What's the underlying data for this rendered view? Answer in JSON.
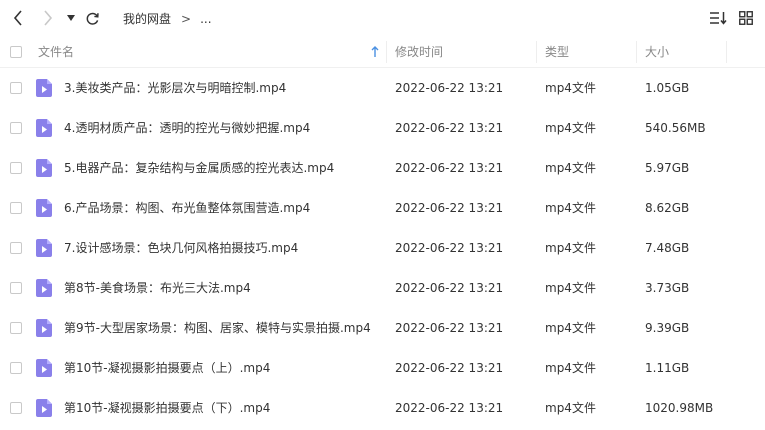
{
  "toolbar": {
    "back_icon": "chevron-left-icon",
    "forward_icon": "chevron-right-icon",
    "dropdown_icon": "caret-down-icon",
    "refresh_icon": "refresh-icon",
    "sort_icon": "sort-list-icon",
    "grid_icon": "grid-view-icon"
  },
  "breadcrumb": {
    "root": "我的网盘",
    "separator": ">",
    "current": "..."
  },
  "columns": {
    "name": "文件名",
    "modified": "修改时间",
    "type": "类型",
    "size": "大小",
    "sort_icon": "arrow-up-icon"
  },
  "colors": {
    "file_icon": "#8a80ea",
    "sort_arrow": "#4a90e2",
    "header_text": "#888888",
    "row_text": "#333333"
  },
  "files": [
    {
      "name": "3.美妆类产品：光影层次与明暗控制.mp4",
      "modified": "2022-06-22 13:21",
      "type": "mp4文件",
      "size": "1.05GB"
    },
    {
      "name": "4.透明材质产品：透明的控光与微妙把握.mp4",
      "modified": "2022-06-22 13:21",
      "type": "mp4文件",
      "size": "540.56MB"
    },
    {
      "name": "5.电器产品：复杂结构与金属质感的控光表达.mp4",
      "modified": "2022-06-22 13:21",
      "type": "mp4文件",
      "size": "5.97GB"
    },
    {
      "name": "6.产品场景：构图、布光鱼整体氛围营造.mp4",
      "modified": "2022-06-22 13:21",
      "type": "mp4文件",
      "size": "8.62GB"
    },
    {
      "name": "7.设计感场景：色块几何风格拍摄技巧.mp4",
      "modified": "2022-06-22 13:21",
      "type": "mp4文件",
      "size": "7.48GB"
    },
    {
      "name": "第8节-美食场景：布光三大法.mp4",
      "modified": "2022-06-22 13:21",
      "type": "mp4文件",
      "size": "3.73GB"
    },
    {
      "name": "第9节-大型居家场景：构图、居家、模特与实景拍摄.mp4",
      "modified": "2022-06-22 13:21",
      "type": "mp4文件",
      "size": "9.39GB"
    },
    {
      "name": "第10节-凝视摄影拍摄要点（上）.mp4",
      "modified": "2022-06-22 13:21",
      "type": "mp4文件",
      "size": "1.11GB"
    },
    {
      "name": "第10节-凝视摄影拍摄要点（下）.mp4",
      "modified": "2022-06-22 13:21",
      "type": "mp4文件",
      "size": "1020.98MB"
    }
  ]
}
